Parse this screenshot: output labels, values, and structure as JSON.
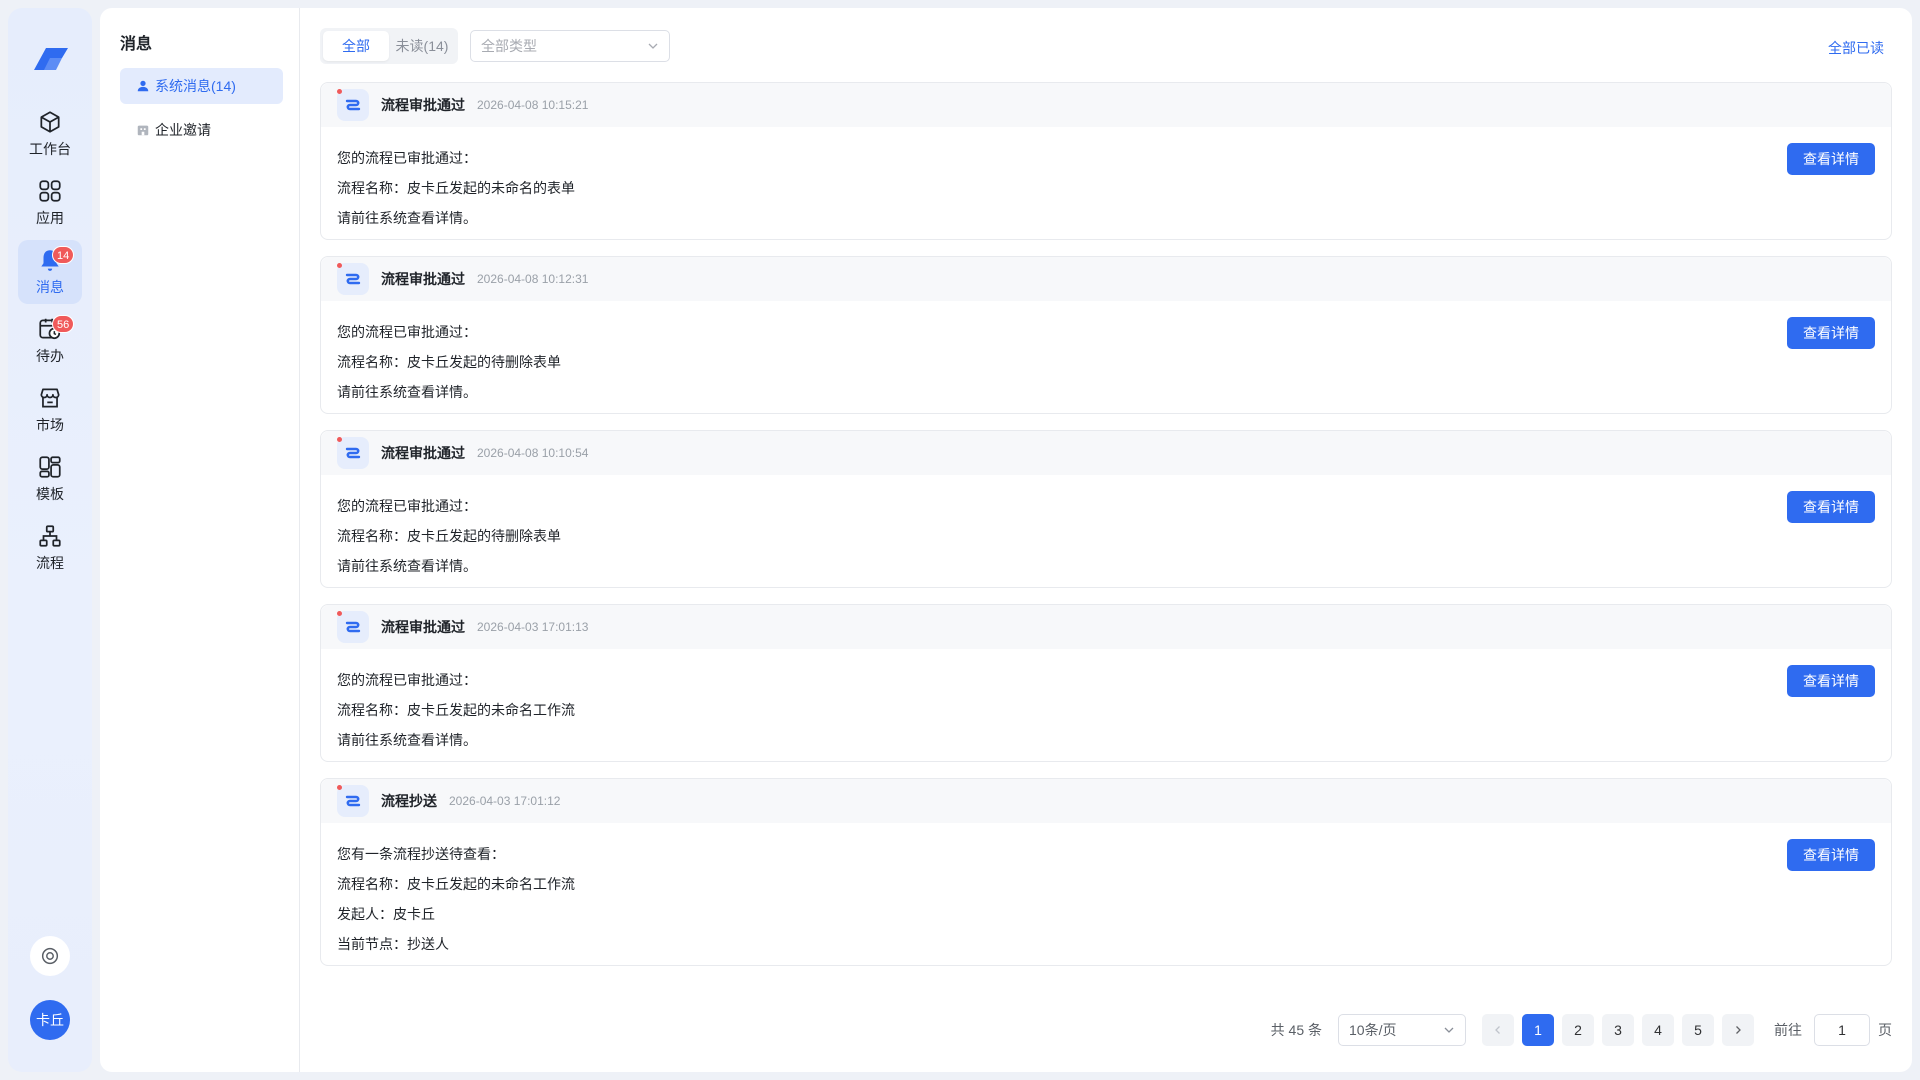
{
  "sidebar": {
    "items": [
      {
        "label": "工作台",
        "icon": "workbench-icon"
      },
      {
        "label": "应用",
        "icon": "apps-grid-icon"
      },
      {
        "label": "消息",
        "icon": "bell-icon",
        "badge": "14",
        "active": true
      },
      {
        "label": "待办",
        "icon": "todo-calendar-icon",
        "badge": "56"
      },
      {
        "label": "市场",
        "icon": "store-icon"
      },
      {
        "label": "模板",
        "icon": "template-icon"
      },
      {
        "label": "流程",
        "icon": "flow-icon"
      }
    ],
    "avatar": "卡丘"
  },
  "subnav": {
    "title": "消息",
    "items": [
      {
        "label": "系统消息(14)",
        "active": true
      },
      {
        "label": "企业邀请"
      }
    ]
  },
  "toolbar": {
    "tabs": [
      "全部",
      "未读(14)"
    ],
    "type_placeholder": "全部类型",
    "mark_all": "全部已读"
  },
  "messages": [
    {
      "title": "流程审批通过",
      "time": "2026-04-08 10:15:21",
      "lines": [
        "您的流程已审批通过：",
        "流程名称：皮卡丘发起的未命名的表单",
        "请前往系统查看详情。"
      ],
      "button": "查看详情"
    },
    {
      "title": "流程审批通过",
      "time": "2026-04-08 10:12:31",
      "lines": [
        "您的流程已审批通过：",
        "流程名称：皮卡丘发起的待删除表单",
        "请前往系统查看详情。"
      ],
      "button": "查看详情"
    },
    {
      "title": "流程审批通过",
      "time": "2026-04-08 10:10:54",
      "lines": [
        "您的流程已审批通过：",
        "流程名称：皮卡丘发起的待删除表单",
        "请前往系统查看详情。"
      ],
      "button": "查看详情"
    },
    {
      "title": "流程审批通过",
      "time": "2026-04-03 17:01:13",
      "lines": [
        "您的流程已审批通过：",
        "流程名称：皮卡丘发起的未命名工作流",
        "请前往系统查看详情。"
      ],
      "button": "查看详情"
    },
    {
      "title": "流程抄送",
      "time": "2026-04-03 17:01:12",
      "lines": [
        "您有一条流程抄送待查看：",
        "流程名称：皮卡丘发起的未命名工作流",
        "发起人：皮卡丘",
        "当前节点：抄送人"
      ],
      "button": "查看详情"
    }
  ],
  "pagination": {
    "total": "共 45 条",
    "page_size": "10条/页",
    "pages": [
      "1",
      "2",
      "3",
      "4",
      "5"
    ],
    "current": "1",
    "goto_prefix": "前往",
    "goto_value": "1",
    "goto_suffix": "页"
  },
  "colors": {
    "accent": "#2f6bf0",
    "badge": "#f05a5a"
  }
}
